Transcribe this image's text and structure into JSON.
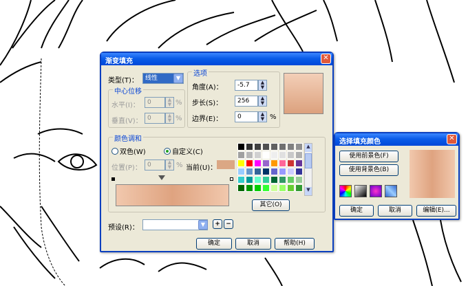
{
  "colors": {
    "title_bar": "#0a5ce8",
    "dialog_bg": "#ece9d8",
    "gradient_start": "#f1c8ad",
    "gradient_mid": "#dfa380",
    "accent_blue": "#0a46d6"
  },
  "fountain_dialog": {
    "title": "渐变填充",
    "close_icon": "close-icon",
    "type_label": "类型(T)：",
    "type_value": "线性",
    "center_offset_label": "中心位移",
    "horizontal_label": "水平(I)：",
    "horizontal_value": "0",
    "vertical_label": "垂直(V)：",
    "vertical_value": "0",
    "percent": "%",
    "options_label": "选项",
    "angle_label": "角度(A)：",
    "angle_value": "-5.7",
    "steps_label": "步长(S)：",
    "steps_value": "256",
    "edge_label": "边界(E)：",
    "edge_value": "0",
    "color_blend_label": "颜色调和",
    "two_color_label": "双色(W)",
    "custom_label": "自定义(C)",
    "position_label": "位置(P)：",
    "position_value": "0",
    "current_label": "当前(U)：",
    "current_color": "#dba784",
    "others_button": "其它(O)",
    "preset_label": "预设(R)：",
    "preset_value": "",
    "ok_button": "确定",
    "cancel_button": "取消",
    "help_button": "帮助(H)"
  },
  "palette": [
    "#000000",
    "#303030",
    "#404040",
    "#505050",
    "#606060",
    "#707070",
    "#808080",
    "#909090",
    "#a0a0a0",
    "#b8b8b8",
    "#d0d0d0",
    "#ffffff",
    "#eeeeee",
    "#e0e0e0",
    "#c8c8c8",
    "#b0b0b0",
    "#ffff00",
    "#ff0000",
    "#ff00ff",
    "#9966cc",
    "#ff9900",
    "#ff6699",
    "#cc3333",
    "#663399",
    "#99ccff",
    "#6699cc",
    "#336699",
    "#003366",
    "#6666cc",
    "#9999ff",
    "#ccccff",
    "#333399",
    "#33cccc",
    "#009999",
    "#66ffcc",
    "#33cc99",
    "#006633",
    "#339966",
    "#66cc66",
    "#99cc99",
    "#006600",
    "#009900",
    "#00cc00",
    "#33ff33",
    "#ccff99",
    "#99ff66",
    "#66cc33",
    "#339933"
  ],
  "fill_color_dialog": {
    "title": "选择填充颜色",
    "close_icon": "close-icon",
    "use_foreground": "使用前景色(F)",
    "use_background": "使用背景色(B)",
    "ok_button": "确定",
    "cancel_button": "取消",
    "edit_button": "编辑(E)..."
  }
}
